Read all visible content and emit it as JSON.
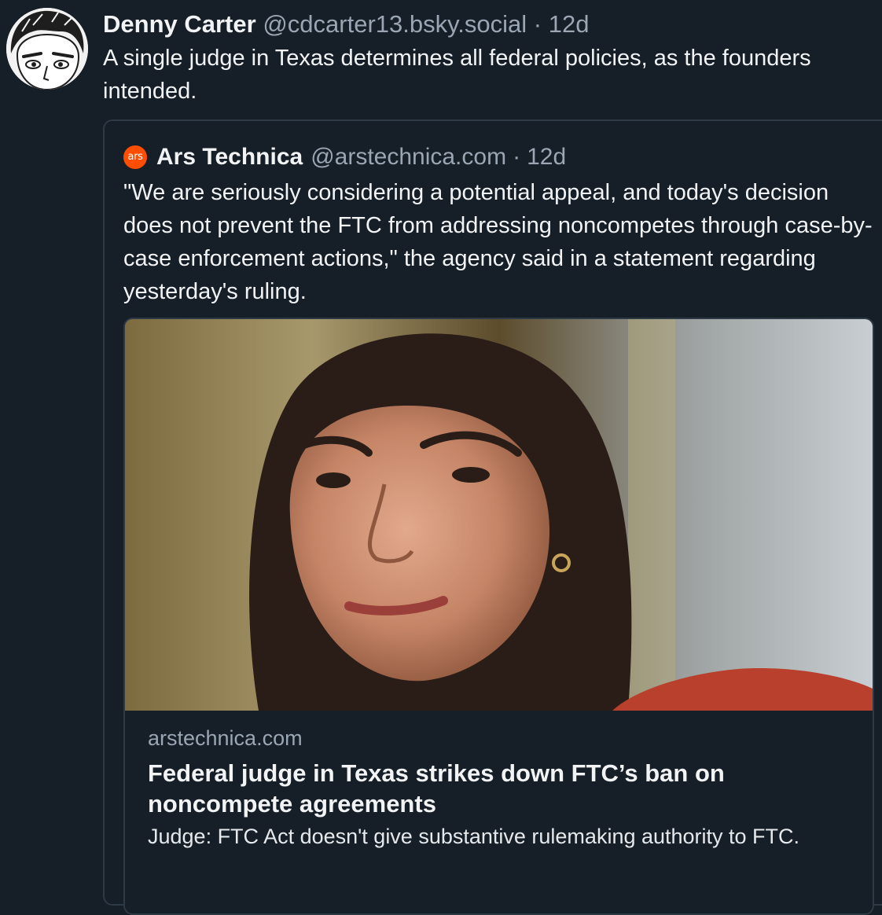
{
  "post": {
    "author": {
      "display_name": "Denny Carter",
      "handle": "@cdcarter13.bsky.social",
      "separator": "·",
      "timestamp": "12d"
    },
    "text": "A single judge in Texas determines all federal policies, as the founders intended."
  },
  "quote": {
    "author": {
      "avatar_text": "ars",
      "display_name": "Ars Technica",
      "handle": "@arstechnica.com",
      "separator": "·",
      "timestamp": "12d"
    },
    "text": "\"We are seriously considering a potential appeal, and today's decision does not prevent the FTC from addressing noncompetes through case-by-case enforcement actions,\" the agency said in a statement regarding yesterday's ruling.",
    "link_card": {
      "domain": "arstechnica.com",
      "title": "Federal judge in Texas strikes down FTC’s ban on noncompete agreements",
      "description": "Judge: FTC Act doesn't give substantive rulemaking authority to FTC."
    }
  },
  "colors": {
    "background": "#161e27",
    "border": "#2e3946",
    "muted_text": "#9aa6b4",
    "primary_text": "#f1f3f5",
    "ars_orange": "#ff4e00"
  }
}
